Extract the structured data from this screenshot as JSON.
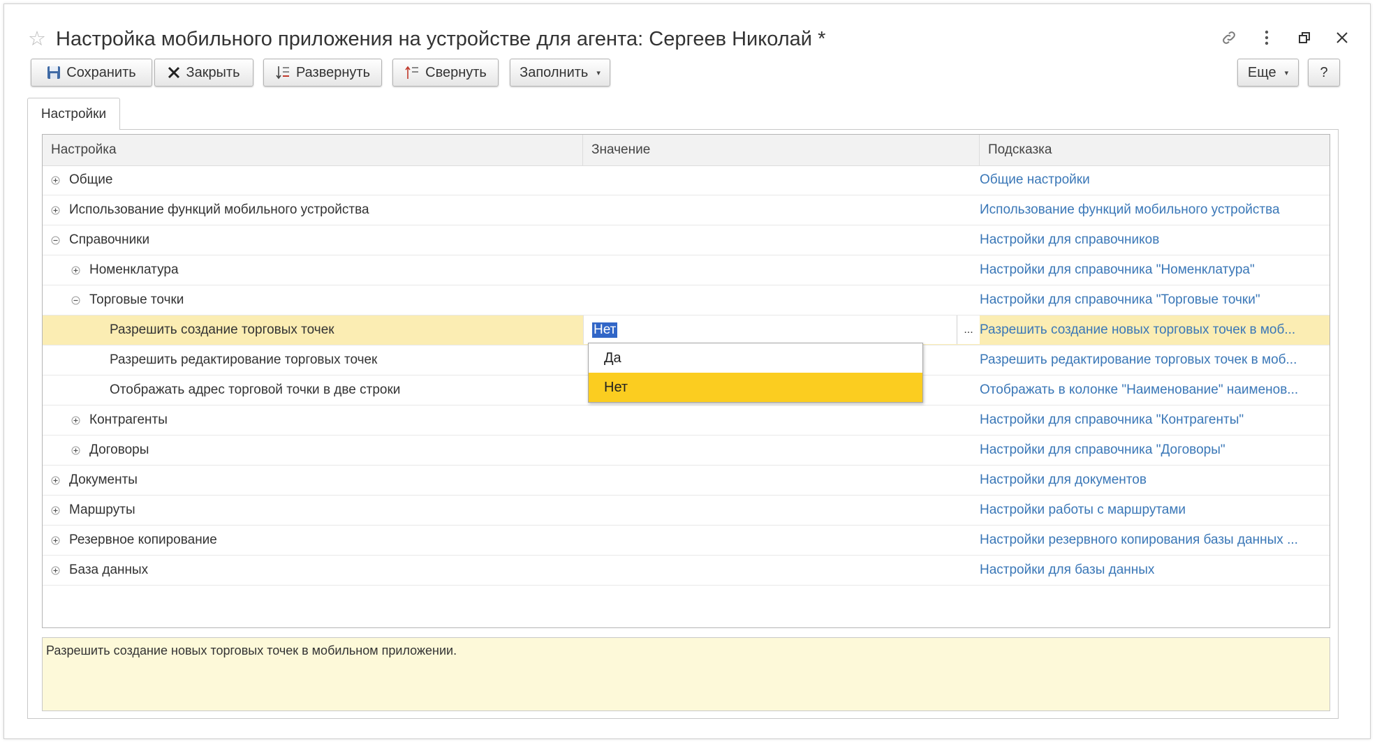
{
  "window": {
    "title": "Настройка мобильного приложения на устройстве для агента: Сергеев Николай *",
    "controls": [
      "link-icon",
      "more-icon",
      "restore-icon",
      "close-icon"
    ]
  },
  "toolbar": {
    "save_label": "Сохранить",
    "close_label": "Закрыть",
    "expand_label": "Развернуть",
    "collapse_label": "Свернуть",
    "fill_label": "Заполнить",
    "more_label": "Еще",
    "help_label": "?"
  },
  "tabs": [
    {
      "label": "Настройки"
    }
  ],
  "grid": {
    "columns": [
      "Настройка",
      "Значение",
      "Подсказка"
    ],
    "rows": [
      {
        "level": 0,
        "toggle": "plus",
        "name": "Общие",
        "value": "",
        "hint": "Общие настройки"
      },
      {
        "level": 0,
        "toggle": "plus",
        "name": "Использование функций мобильного устройства",
        "value": "",
        "hint": "Использование функций мобильного устройства"
      },
      {
        "level": 0,
        "toggle": "minus",
        "name": "Справочники",
        "value": "",
        "hint": "Настройки для справочников"
      },
      {
        "level": 1,
        "toggle": "plus",
        "name": "Номенклатура",
        "value": "",
        "hint": "Настройки для справочника \"Номенклатура\""
      },
      {
        "level": 1,
        "toggle": "minus",
        "name": "Торговые точки",
        "value": "",
        "hint": "Настройки для справочника \"Торговые точки\""
      },
      {
        "level": 2,
        "toggle": "none",
        "name": "Разрешить создание торговых точек",
        "value": "Нет",
        "hint": "Разрешить создание новых торговых точек в моб...",
        "selected": true,
        "choice_button": "..."
      },
      {
        "level": 2,
        "toggle": "none",
        "name": "Разрешить редактирование торговых точек",
        "value": "",
        "hint": "Разрешить редактирование торговых точек в моб..."
      },
      {
        "level": 2,
        "toggle": "none",
        "name": "Отображать адрес торговой точки в две строки",
        "value": "",
        "hint": "Отображать в колонке \"Наименование\" наименов..."
      },
      {
        "level": 1,
        "toggle": "plus",
        "name": "Контрагенты",
        "value": "",
        "hint": "Настройки для справочника \"Контрагенты\""
      },
      {
        "level": 1,
        "toggle": "plus",
        "name": "Договоры",
        "value": "",
        "hint": "Настройки для справочника \"Договоры\""
      },
      {
        "level": 0,
        "toggle": "plus",
        "name": "Документы",
        "value": "",
        "hint": "Настройки для документов"
      },
      {
        "level": 0,
        "toggle": "plus",
        "name": "Маршруты",
        "value": "",
        "hint": "Настройки работы с маршрутами"
      },
      {
        "level": 0,
        "toggle": "plus",
        "name": "Резервное копирование",
        "value": "",
        "hint": "Настройки резервного копирования базы данных ..."
      },
      {
        "level": 0,
        "toggle": "plus",
        "name": "База данных",
        "value": "",
        "hint": "Настройки для базы данных"
      }
    ]
  },
  "dropdown": {
    "options": [
      "Да",
      "Нет"
    ],
    "highlighted": "Нет"
  },
  "hint_box": {
    "text": "Разрешить создание новых торговых точек в мобильном приложении."
  },
  "colors": {
    "link": "#3a77b7",
    "selected_row": "#fbedb3",
    "dropdown_highlight": "#fbcd20",
    "hint_background": "#fdf9d9",
    "value_selection": "#3166c7"
  }
}
